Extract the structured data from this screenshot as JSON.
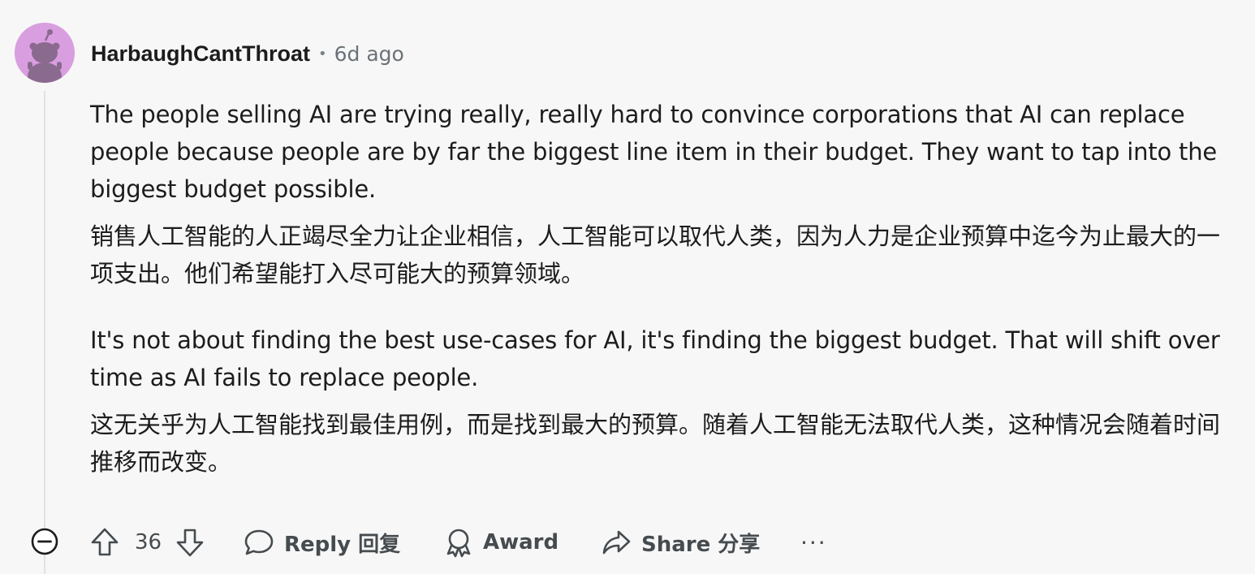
{
  "comment": {
    "username": "HarbaughCantThroat",
    "separator": "•",
    "timestamp": "6d ago",
    "paragraphs": [
      {
        "lang": "en",
        "text": "The people selling AI are trying really, really hard to convince corporations that AI can replace people because people are by far the biggest line item in their budget. They want to tap into the biggest budget possible."
      },
      {
        "lang": "zh",
        "text": "销售人工智能的人正竭尽全力让企业相信，人工智能可以取代人类，因为人力是企业预算中迄今为止最大的一项支出。他们希望能打入尽可能大的预算领域。"
      },
      {
        "lang": "en",
        "text": "It's not about finding the best use-cases for AI, it's finding the biggest budget. That will shift over time as AI fails to replace people."
      },
      {
        "lang": "zh",
        "text": "这无关乎为人工智能找到最佳用例，而是找到最大的预算。随着人工智能无法取代人类，这种情况会随着时间推移而改变。"
      }
    ]
  },
  "actions": {
    "vote_count": "36",
    "reply_label": "Reply 回复",
    "award_label": "Award",
    "share_label": "Share 分享",
    "more_label": "···"
  },
  "icons": {
    "avatar": "reddit-snoo-avatar-icon",
    "collapse": "minus-circle-icon",
    "upvote": "arrow-up-icon",
    "downvote": "arrow-down-icon",
    "reply": "speech-bubble-icon",
    "award": "award-ribbon-icon",
    "share": "share-arrow-icon"
  },
  "colors": {
    "background": "#f7f7f7",
    "avatar_bg": "#d99ee0",
    "text": "#1c1c1c",
    "muted": "#6a7278",
    "action": "#454b4f",
    "thread_line": "#dfe1e3"
  }
}
